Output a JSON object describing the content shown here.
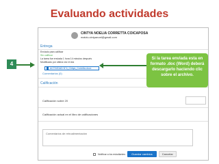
{
  "slide": {
    "title": "Evaluando actividades"
  },
  "header": {
    "user_name": "CINTYA NOELIA CORRETTA COICAPOSA",
    "user_email": "malviu.cintyanoel@gmail.com"
  },
  "submission": {
    "section_title": "Entrega",
    "status": "Enviado para calificar",
    "grading_status": "Sin calificar",
    "time_info": "La tarea fue enviada 1 hora 14 minutos después",
    "edit_info": "Modificado por última vez el día",
    "file_name": "ACTIVIDAD N°4_Cintya_Corretta.docx",
    "comments": "Comentarios (0)"
  },
  "grading": {
    "section_title": "Calificación",
    "grade_label": "Calificación sobre 20",
    "current_grade_label": "Calificación actual en el libro de calificaciones",
    "feedback_placeholder": "Comentarios de retroalimentación"
  },
  "footer": {
    "notify_label": "Notificar a los estudiantes",
    "save_label": "Guardar cambios",
    "cancel_label": "Cancelar"
  },
  "annotation": {
    "badge": "4",
    "callout_text": "Si la tarea enviada esta en formato .doc (Word) deberá descargarlo haciendo clic sobre el archivo."
  },
  "colors": {
    "title": "#c0392b",
    "accent": "#1a73c9",
    "callout": "#7cc342",
    "badge": "#2e8b57"
  }
}
